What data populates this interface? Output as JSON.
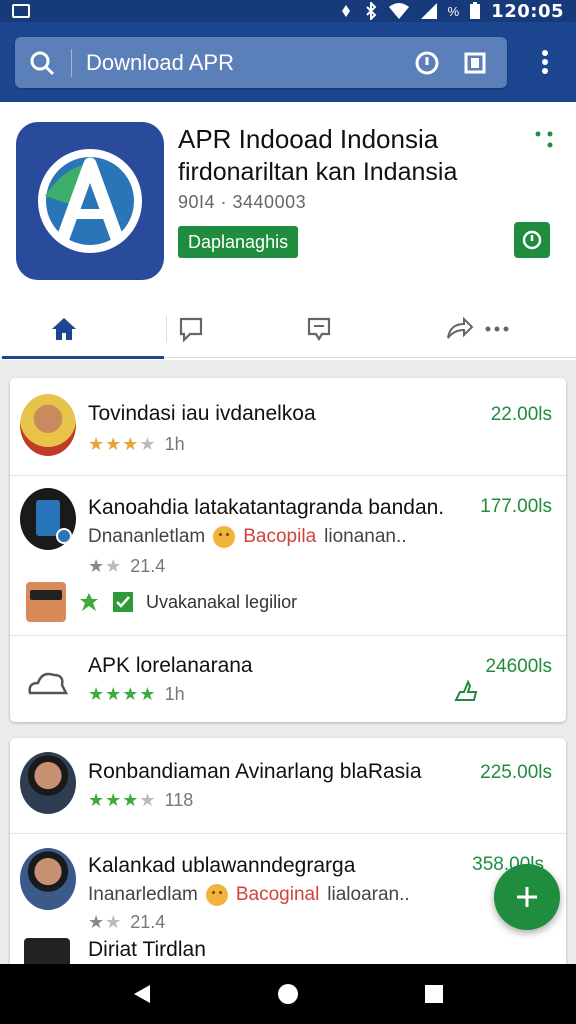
{
  "status_bar": {
    "time": "120:05",
    "battery_text": "%"
  },
  "search": {
    "query": "Download APR"
  },
  "app": {
    "name": "APR Indooad Indonsia",
    "subtitle": "firdonariltan kan Indansia",
    "meta": "90I4 · 3440003",
    "download_label": "Daplanaghis"
  },
  "tabs": [
    {
      "name": "home",
      "icon": "home-icon"
    },
    {
      "name": "reviews",
      "icon": "comment-icon"
    },
    {
      "name": "messages",
      "icon": "message-icon"
    },
    {
      "name": "share",
      "icon": "share-icon"
    }
  ],
  "list1": [
    {
      "title": "Tovindasi iau ivdanelkoa",
      "count": "22.00ls",
      "rating": 3,
      "meta": "1h"
    },
    {
      "title": "Kanoahdia latakatantagranda bandan.",
      "count": "177.00ls",
      "desc_a": "Dnananletlam",
      "desc_b": "Bacopila",
      "desc_c": "lionanan..",
      "rating": 2,
      "meta": "21.4",
      "sub_label": "Uvakanakal legilior"
    },
    {
      "title": "APK lorelanarana",
      "count": "24600ls",
      "rating": 4,
      "meta": "1h"
    }
  ],
  "list2": [
    {
      "title": "Ronbandiaman Avinarlang blaRasia",
      "count": "225.00ls",
      "rating": 3,
      "meta": "118"
    },
    {
      "title": "Kalankad ublawanndegrarga",
      "count": "358.00ls",
      "desc_a": "Inanarledlam",
      "desc_b": "Bacoginal",
      "desc_c": "lialoaran..",
      "rating": 2,
      "meta": "21.4"
    },
    {
      "title": "Diriat Tirdlan",
      "count": ""
    }
  ],
  "colors": {
    "primary": "#1d4690",
    "accent": "#1f8c3e",
    "star": "#e8a33a"
  }
}
